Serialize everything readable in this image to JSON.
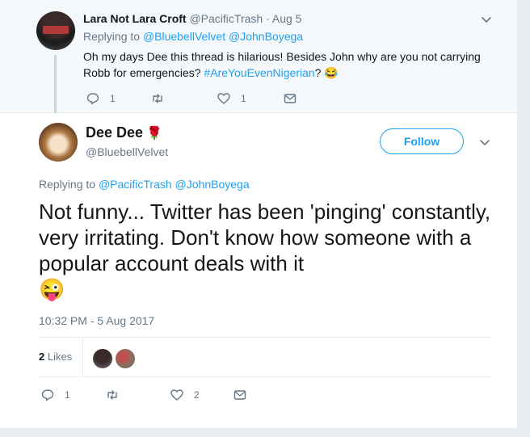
{
  "reply_tweet": {
    "name": "Lara Not Lara Croft",
    "handle": "@PacificTrash",
    "separator": "·",
    "date": "Aug 5",
    "replying_prefix": "Replying to",
    "replying_to_1": "@BluebellVelvet",
    "replying_to_2": "@JohnBoyega",
    "text_part_1": "Oh my days Dee this thread is hilarious! Besides John why are you not carrying Robb for emergencies?",
    "hashtag": "#AreYouEvenNigerian",
    "text_part_2": "?",
    "emoji": "😂",
    "reply_count": "1",
    "retweet_count": "",
    "like_count": "1"
  },
  "main_tweet": {
    "name": "Dee Dee",
    "name_emoji": "🌹",
    "handle": "@BluebellVelvet",
    "follow_label": "Follow",
    "replying_prefix": "Replying to",
    "replying_to_1": "@PacificTrash",
    "replying_to_2": "@JohnBoyega",
    "text": "Not funny... Twitter has been 'pinging' constantly, very irritating. Don't know how someone with a popular account deals with it",
    "emoji": "😜",
    "timestamp": "10:32 PM - 5 Aug 2017",
    "likes_count": "2",
    "likes_label": "Likes",
    "reply_count": "1",
    "retweet_count": "",
    "like_count": "2"
  },
  "colors": {
    "accent": "#1da1f2",
    "muted": "#657786",
    "background": "#e6ecf0",
    "reply_background": "#f5f8fa"
  },
  "icons": {
    "reply": "reply-icon",
    "retweet": "retweet-icon",
    "like": "heart-icon",
    "message": "envelope-icon",
    "more": "chevron-down-icon"
  }
}
